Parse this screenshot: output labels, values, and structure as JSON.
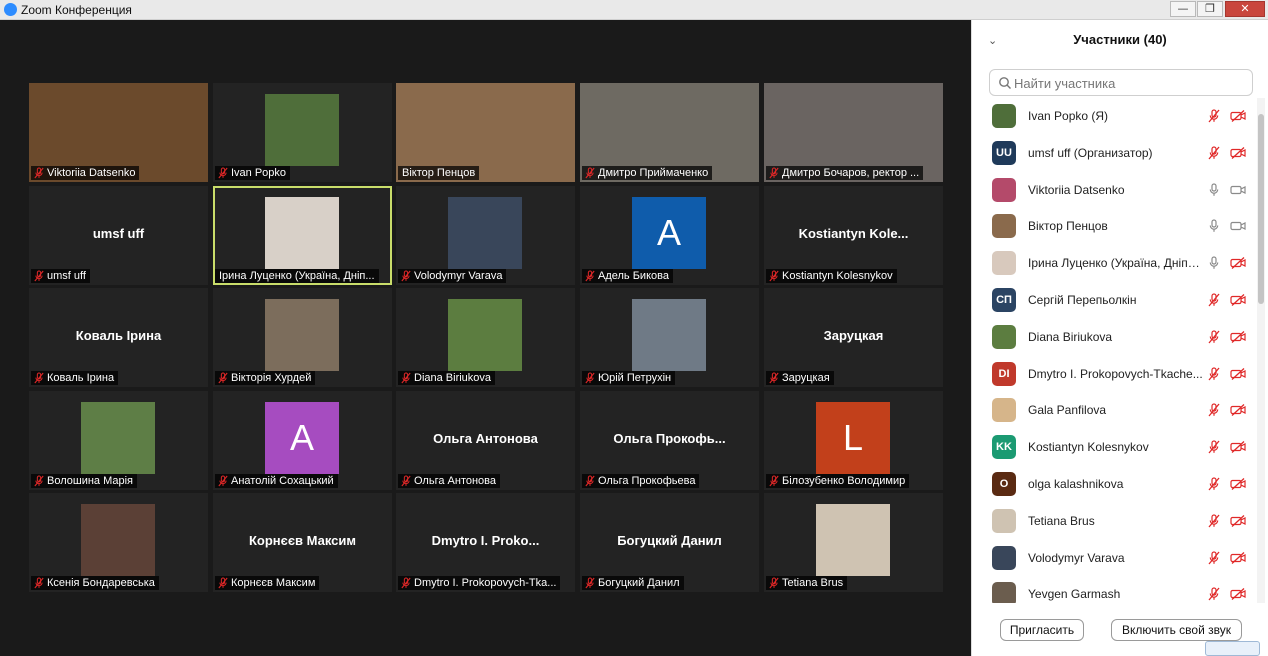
{
  "window": {
    "title": "Zoom Конференция",
    "minimize": "—",
    "maximize": "❐",
    "close": "✕"
  },
  "tiles": [
    {
      "label": "Viktoriia Datsenko",
      "display": "photo",
      "photo_bg": "#6b4a2c",
      "muted": true
    },
    {
      "label": "Ivan Popko",
      "display": "photo",
      "photo_bg": "#4f6e3a",
      "muted": true
    },
    {
      "label": "Віктор Пенцов",
      "display": "photo",
      "photo_bg": "#8a6a4c",
      "muted": false
    },
    {
      "label": "Дмитро Приймаченко",
      "display": "photo",
      "photo_bg": "#6e6a62",
      "muted": true
    },
    {
      "label": "Дмитро Бочаров, ректор ...",
      "display": "photo",
      "photo_bg": "#6a6461",
      "muted": true
    },
    {
      "label": "umsf uff",
      "display": "name",
      "center": "umsf uff",
      "muted": true
    },
    {
      "label": "Ірина Луценко (Україна, Дніп...",
      "display": "photo",
      "photo_bg": "#d8d0c8",
      "muted": false,
      "active": true
    },
    {
      "label": "Volodymyr Varava",
      "display": "photo",
      "photo_bg": "#39465a",
      "muted": true
    },
    {
      "label": "Адель Бикова",
      "display": "letter",
      "letter": "A",
      "letter_bg": "#0f5cab",
      "muted": true
    },
    {
      "label": "Kostiantyn Kolesnykov",
      "display": "name",
      "center": "Kostiantyn Kole...",
      "muted": true
    },
    {
      "label": "Коваль Ірина",
      "display": "name",
      "center": "Коваль Ірина",
      "muted": true
    },
    {
      "label": "Вікторія Хурдей",
      "display": "photo",
      "photo_bg": "#7c6d5c",
      "muted": true
    },
    {
      "label": "Diana Biriukova",
      "display": "photo",
      "photo_bg": "#5c7d40",
      "muted": true
    },
    {
      "label": "Юрій Петрухін",
      "display": "photo",
      "photo_bg": "#6f7a86",
      "muted": true
    },
    {
      "label": "Заруцкая",
      "display": "name",
      "center": "Заруцкая",
      "muted": true
    },
    {
      "label": "Волошина Марія",
      "display": "photo",
      "photo_bg": "#5e7e46",
      "muted": true
    },
    {
      "label": "Анатолій Сохацький",
      "display": "letter",
      "letter": "A",
      "letter_bg": "#a64cc0",
      "muted": true
    },
    {
      "label": "Ольга Антонова",
      "display": "name",
      "center": "Ольга Антонова",
      "muted": true
    },
    {
      "label": "Ольга Прокофьева",
      "display": "name",
      "center": "Ольга  Прокофь...",
      "muted": true
    },
    {
      "label": "Білозубенко Володимир",
      "display": "letter",
      "letter": "L",
      "letter_bg": "#c2401b",
      "muted": true
    },
    {
      "label": "Ксенія Бондаревська",
      "display": "photo",
      "photo_bg": "#5b4036",
      "muted": true
    },
    {
      "label": "Корнєєв Максим",
      "display": "name",
      "center": "Корнєєв Максим",
      "muted": true
    },
    {
      "label": "Dmytro I. Prokopovych-Tka...",
      "display": "name",
      "center": "Dmytro  I.  Proko...",
      "muted": true
    },
    {
      "label": "Богуцкий Данил",
      "display": "name",
      "center": "Богуцкий Данил",
      "muted": true
    },
    {
      "label": "Tetiana Brus",
      "display": "photo",
      "photo_bg": "#cfc3b2",
      "muted": true
    }
  ],
  "panel": {
    "collapse_icon": "⌄",
    "title": "Участники (40)",
    "search_placeholder": "Найти участника",
    "participants": [
      {
        "name": "Ivan Popko (Я)",
        "avatar": "",
        "avatar_bg": "#4f6e3a",
        "mic": "muted",
        "video": "off"
      },
      {
        "name": "umsf uff (Организатор)",
        "avatar": "UU",
        "avatar_bg": "#1f3a5a",
        "mic": "muted",
        "video": "off"
      },
      {
        "name": "Viktoriia Datsenko",
        "avatar": "",
        "avatar_bg": "#b44a6a",
        "mic": "on",
        "video": "on"
      },
      {
        "name": "Віктор Пенцов",
        "avatar": "",
        "avatar_bg": "#8a6a4c",
        "mic": "on",
        "video": "on"
      },
      {
        "name": "Ірина Луценко (Україна, Дніпр...",
        "avatar": "",
        "avatar_bg": "#d8c9bd",
        "mic": "on",
        "video": "off"
      },
      {
        "name": "Сергій Перепьолкін",
        "avatar": "СП",
        "avatar_bg": "#2b4463",
        "mic": "muted",
        "video": "off"
      },
      {
        "name": "Diana Biriukova",
        "avatar": "",
        "avatar_bg": "#5c7d40",
        "mic": "muted",
        "video": "off"
      },
      {
        "name": "Dmytro I. Prokopovych-Tkache...",
        "avatar": "DI",
        "avatar_bg": "#c0392b",
        "mic": "muted",
        "video": "off"
      },
      {
        "name": "Gala Panfilova",
        "avatar": "",
        "avatar_bg": "#d6b58a",
        "mic": "muted",
        "video": "off"
      },
      {
        "name": "Kostiantyn Kolesnykov",
        "avatar": "KK",
        "avatar_bg": "#1b9a72",
        "mic": "muted",
        "video": "off"
      },
      {
        "name": "olga kalashnikova",
        "avatar": "O",
        "avatar_bg": "#5a2a12",
        "mic": "muted",
        "video": "off"
      },
      {
        "name": "Tetiana Brus",
        "avatar": "",
        "avatar_bg": "#cfc3b2",
        "mic": "muted",
        "video": "off"
      },
      {
        "name": "Volodymyr Varava",
        "avatar": "",
        "avatar_bg": "#39465a",
        "mic": "muted",
        "video": "off"
      },
      {
        "name": "Yevgen Garmash",
        "avatar": "",
        "avatar_bg": "#6b5d4e",
        "mic": "muted",
        "video": "off"
      }
    ],
    "invite_button": "Пригласить",
    "unmute_button": "Включить свой звук"
  },
  "colors": {
    "muted_red": "#e02828",
    "icon_gray": "#8a8a8a",
    "active_outline": "#c9dd6a"
  }
}
